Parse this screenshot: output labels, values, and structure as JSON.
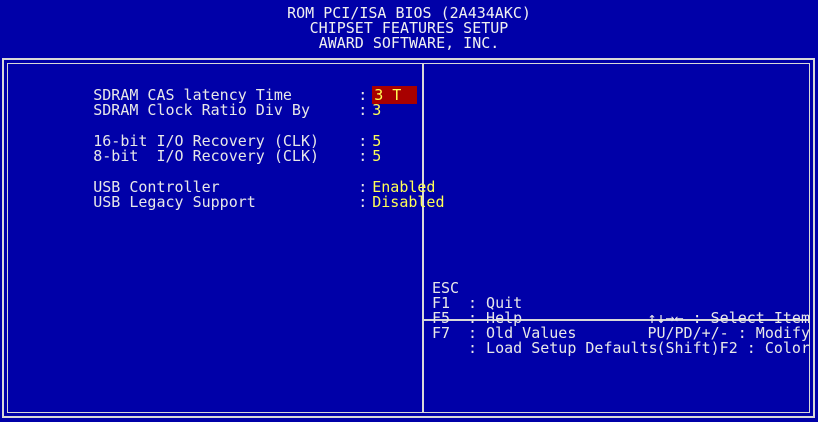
{
  "header": {
    "line1": "ROM PCI/ISA BIOS (2A434AKC)",
    "line2": "CHIPSET FEATURES SETUP",
    "line3": "AWARD SOFTWARE, INC."
  },
  "settings": [
    {
      "label": "SDRAM CAS latency Time",
      "value": "3 T",
      "selected": true
    },
    {
      "label": "SDRAM Clock Ratio Div By",
      "value": "3"
    },
    {
      "label": "16-bit I/O Recovery (CLK)",
      "value": "5"
    },
    {
      "label": "8-bit  I/O Recovery (CLK)",
      "value": "5"
    },
    {
      "label": "USB Controller",
      "value": "Enabled"
    },
    {
      "label": "USB Legacy Support",
      "value": "Disabled"
    }
  ],
  "help": [
    {
      "key": "ESC",
      "desc": ": Quit",
      "right": "↑↓→← : Select Item"
    },
    {
      "key": "F1",
      "desc": ": Help",
      "right": "PU/PD/+/- : Modify"
    },
    {
      "key": "F5",
      "desc": ": Old Values",
      "right": "(Shift)F2 : Color"
    },
    {
      "key": "F7",
      "desc": ": Load Setup Defaults",
      "right": ""
    }
  ],
  "colors": {
    "background": "#0000a8",
    "value_text": "#ffff55",
    "highlight": "#a80000"
  }
}
